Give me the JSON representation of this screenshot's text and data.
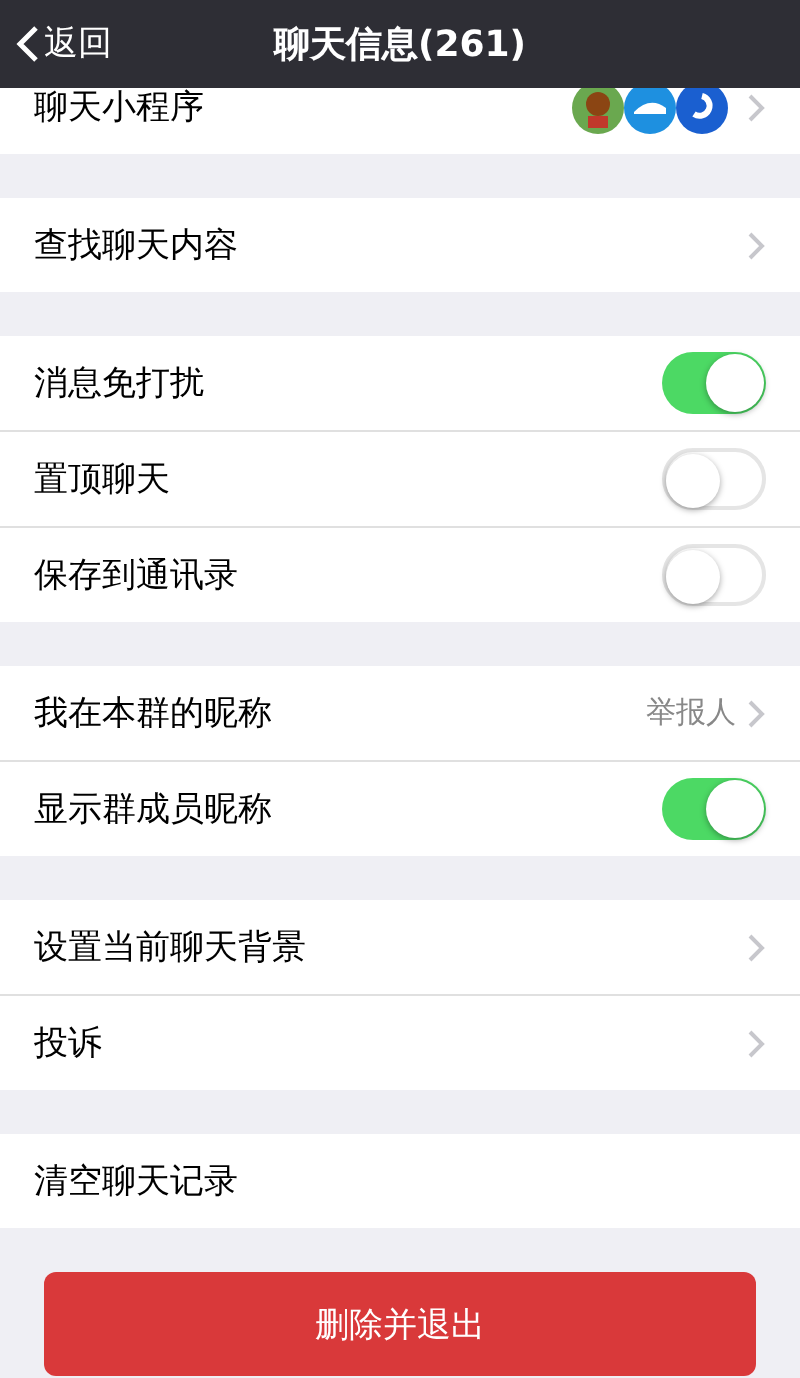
{
  "nav": {
    "back": "返回",
    "title": "聊天信息(261)"
  },
  "sections": [
    [
      {
        "kind": "apps",
        "label": "聊天小程序"
      }
    ],
    [
      {
        "kind": "link",
        "label": "查找聊天内容"
      }
    ],
    [
      {
        "kind": "toggle",
        "label": "消息免打扰",
        "on": true
      },
      {
        "kind": "toggle",
        "label": "置顶聊天",
        "on": false
      },
      {
        "kind": "toggle",
        "label": "保存到通讯录",
        "on": false
      }
    ],
    [
      {
        "kind": "link",
        "label": "我在本群的昵称",
        "value": "举报人"
      },
      {
        "kind": "toggle",
        "label": "显示群成员昵称",
        "on": true
      }
    ],
    [
      {
        "kind": "link",
        "label": "设置当前聊天背景"
      },
      {
        "kind": "link",
        "label": "投诉"
      }
    ],
    [
      {
        "kind": "plain",
        "label": "清空聊天记录"
      }
    ]
  ],
  "delete_button": "删除并退出"
}
